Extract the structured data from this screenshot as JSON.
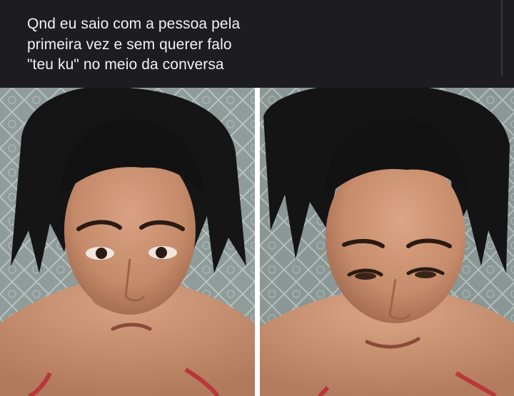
{
  "post": {
    "caption": "Qnd eu saio com a pessoa pela\nprimeira vez e sem querer falo\n\"teu ku\" no meio da conversa"
  },
  "images": {
    "left": {
      "description_icon": "photo-neutral-face-icon"
    },
    "right": {
      "description_icon": "photo-smirking-face-icon"
    }
  },
  "colors": {
    "background": "#1d1d1f",
    "caption_text": "#f2f2f2",
    "wall": "#8c9a97",
    "skin": "#c98f6e",
    "hair": "#141414",
    "strap": "#b8383a"
  }
}
